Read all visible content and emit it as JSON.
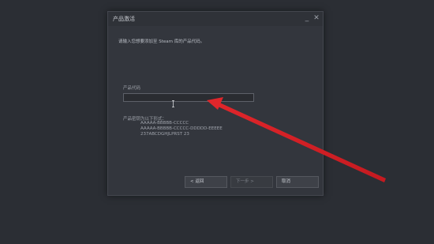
{
  "dialog": {
    "title": "产品激活",
    "minimize_label": "_",
    "close_label": "✕",
    "intro_text": "请输入您想要添加至 Steam 库的产品代码。",
    "field_label": "产品代码",
    "key_value": "",
    "format_title": "产品密钥为以下形式：",
    "format_lines": [
      "AAAAA-BBBBB-CCCCC",
      "AAAAA-BBBBB-CCCCC-DDDDD-EEEEE",
      "237ABCDGHJLPRST 23"
    ],
    "buttons": {
      "back": "< 返回",
      "next": "下一步 >",
      "cancel": "取消"
    }
  },
  "annotation": {
    "arrow_color": "#e0262b"
  }
}
